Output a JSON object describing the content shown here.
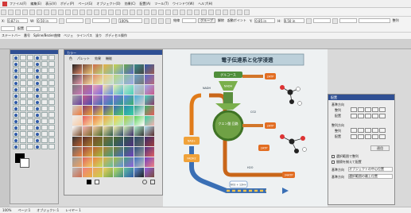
{
  "menubar": {
    "items": [
      "ファイル(F)",
      "編集(E)",
      "表示(V)",
      "ボディ(P)",
      "ページ(G)",
      "オブジェクト(O)",
      "効果(C)",
      "配置(A)",
      "ツール(T)",
      "ウインドウ(W)",
      "ヘルプ(H)"
    ]
  },
  "toolbar3": {
    "labels": [
      "ステートバー",
      "番号",
      "Spline/Bezier曲線",
      "ベジェ",
      "ラインパス",
      "塗り",
      "ボディセル操作"
    ]
  },
  "prop_bar": {
    "x_label": "X:",
    "x_value": "0.87 in",
    "y_label": "Y:",
    "y_value": "0.85 in",
    "w_label": "W:",
    "w_value": "0.50 in",
    "h_label": "H:",
    "h_value": "0.50 in",
    "zoom_value": "100%",
    "group_button": "グループ",
    "ungroup_label": "解除",
    "connect_label": "結線",
    "align_label": "整列",
    "anchor_label": "起動ポイント",
    "distribute_label": "配置"
  },
  "color_panel": {
    "title": "カラー",
    "tabs": [
      "色",
      "パレット",
      "効果",
      "機能"
    ]
  },
  "diagram": {
    "title": "電子伝達系と化学浸透",
    "labels": {
      "glucose": "グルコース",
      "nadh": "NADH",
      "atp_top": "2ATP",
      "citric": "クエン酸\n回路",
      "atp_mid": "2ATP",
      "atp_bot": "34ATP",
      "nad": "NAD+",
      "fad": "FADH2",
      "co2": "CO2",
      "h2o": "H2O",
      "o2": "6O2 + 12H+",
      "nadh2": "NADH",
      "atp_right": "2ATP"
    }
  },
  "info_panel": {
    "title": "配置",
    "sec1": "基準方向",
    "sec1_row1": "整列",
    "sec1_row2": "配置",
    "sec2": "整列方向",
    "sec2_row1": "整列",
    "sec2_row2": "配置",
    "apply_button": "適用",
    "chk1": "選択範囲で整列",
    "chk2": "間隔を揃えて配置",
    "field1_label": "基準方向",
    "field1_value": "オブジェクトの中心位置",
    "field2_label": "基準方向",
    "field2_value": "選択範囲の最上位置"
  },
  "statusbar": {
    "items": [
      "100%",
      "ページ:1",
      "オブジェクト:1",
      "レイヤー 1"
    ]
  },
  "colors": {
    "accent": "#2f4f93",
    "menu_bg": "#f0f0f0"
  }
}
